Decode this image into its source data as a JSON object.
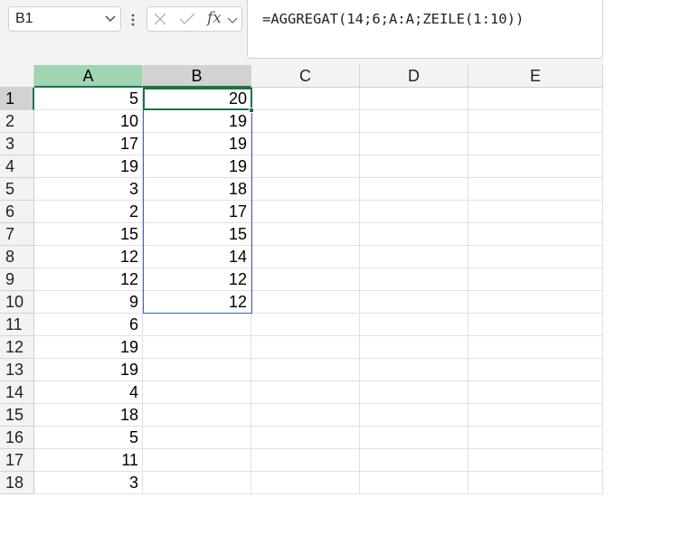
{
  "name_box": {
    "value": "B1"
  },
  "formula_bar": {
    "fx_label": "fx",
    "formula": "=AGGREGAT(14;6;A:A;ZEILE(1:10))"
  },
  "columns": [
    "A",
    "B",
    "C",
    "D",
    "E"
  ],
  "rows": [
    "1",
    "2",
    "3",
    "4",
    "5",
    "6",
    "7",
    "8",
    "9",
    "10",
    "11",
    "12",
    "13",
    "14",
    "15",
    "16",
    "17",
    "18"
  ],
  "column_a": [
    "5",
    "10",
    "17",
    "19",
    "3",
    "2",
    "15",
    "12",
    "12",
    "9",
    "6",
    "19",
    "19",
    "4",
    "18",
    "5",
    "11",
    "3"
  ],
  "column_b": [
    "20",
    "19",
    "19",
    "19",
    "18",
    "17",
    "15",
    "14",
    "12",
    "12"
  ],
  "colors": {
    "accent_green": "#1e7145",
    "selected_column_header": "#9fd5b3",
    "range_border": "#3a66b5"
  }
}
